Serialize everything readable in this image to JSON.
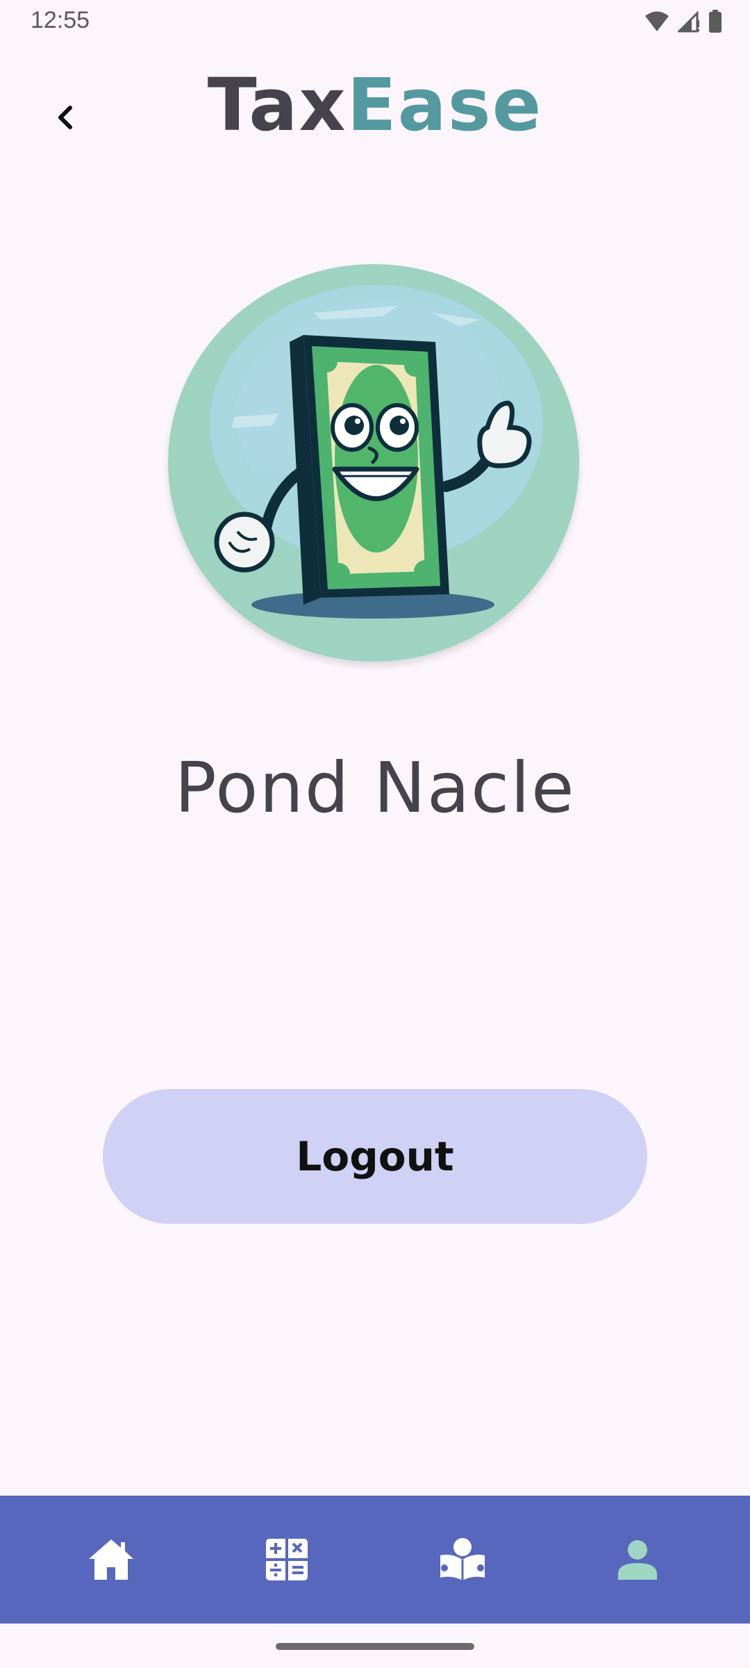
{
  "status_bar": {
    "time": "12:55"
  },
  "header": {
    "title_part1": "Tax",
    "title_part2": "Ease",
    "back_icon": "chevron-left-icon"
  },
  "profile": {
    "name": "Pond Nacle",
    "avatar_alt": "money-mascot"
  },
  "actions": {
    "logout_label": "Logout"
  },
  "bottom_nav": {
    "items": [
      {
        "icon": "home-icon",
        "active": false
      },
      {
        "icon": "calculator-icon",
        "active": false
      },
      {
        "icon": "reading-icon",
        "active": false
      },
      {
        "icon": "profile-icon",
        "active": true
      }
    ]
  },
  "colors": {
    "background": "#FCF5FC",
    "title_dark": "#45434C",
    "title_accent": "#5499A0",
    "logout_button": "#CFD1F5",
    "nav_background": "#5767BD",
    "nav_active": "#9FD6C3"
  }
}
